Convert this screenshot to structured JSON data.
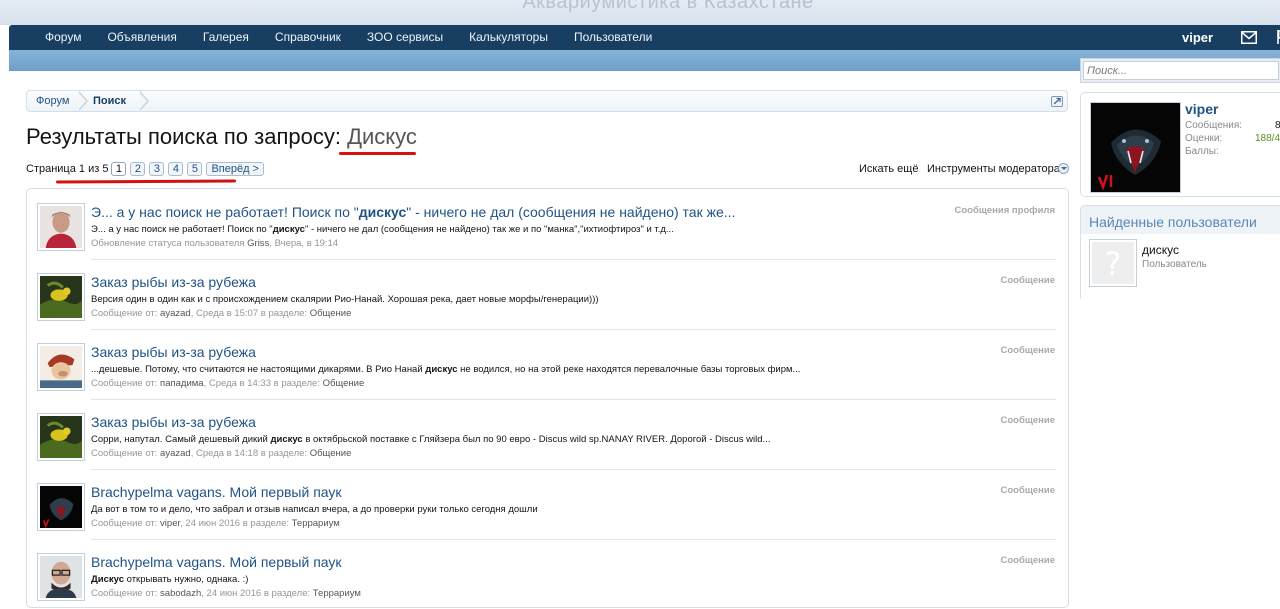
{
  "site_title": "Аквариумистика в Казахстане",
  "nav": {
    "tabs": [
      {
        "label": "Форум"
      },
      {
        "label": "Объявления"
      },
      {
        "label": "Галерея"
      },
      {
        "label": "Справочник"
      },
      {
        "label": "ЗОО сервисы"
      },
      {
        "label": "Калькуляторы"
      },
      {
        "label": "Пользователи"
      }
    ],
    "username": "viper",
    "icons": [
      "mail-icon",
      "flag-icon"
    ]
  },
  "quick_search": {
    "placeholder": "Поиск..."
  },
  "breadcrumb": {
    "items": [
      "Форум",
      "Поиск"
    ]
  },
  "heading": {
    "prefix": "Результаты поиска по запросу:",
    "term": "Дискус"
  },
  "pagination": {
    "label": "Страница 1 из 5",
    "pages": [
      "1",
      "2",
      "3",
      "4",
      "5"
    ],
    "current": "1",
    "next": "Вперёд >"
  },
  "actions": {
    "search_more": "Искать ещё",
    "mod_tools": "Инструменты модератора"
  },
  "annotation_color": "#d41212",
  "results": [
    {
      "title": "Э... а у нас поиск не работает! Поиск по \"дискус\" - ничего не дал (сообщения не найдено) так же...",
      "title_parts": [
        "Э... а у нас поиск не работает! Поиск по \"",
        "дискус",
        "\" - ничего не дал (сообщения не найдено) так же..."
      ],
      "snippet_parts": [
        "Э... а у нас поиск не работает! Поиск по \"",
        "дискус",
        "\" - ничего не дал (сообщения не найдено) так же и по \"манка\",\"ихтиофтироз\" и т.д..."
      ],
      "meta_prefix": "Обновление статуса пользователя",
      "author": "Griss",
      "date": "Вчера, в 19:14",
      "section_prefix": "",
      "section": "",
      "type": "Сообщения профиля",
      "avatar": "man-photo"
    },
    {
      "title_parts": [
        "Заказ рыбы из-за рубежа",
        "",
        ""
      ],
      "snippet_parts": [
        "Версия один в один как и с происхождением скалярии Рио-Нанай. Хорошая река, дает новые морфы/генерации)))",
        "",
        ""
      ],
      "meta_prefix": "Сообщение от:",
      "author": "ayazad",
      "date": "Среда в 15:07",
      "section_prefix": "в разделе:",
      "section": "Общение",
      "type": "Сообщение",
      "avatar": "bird-photo"
    },
    {
      "title_parts": [
        "Заказ рыбы из-за рубежа",
        "",
        ""
      ],
      "snippet_parts": [
        "...дешевые. Потому, что считаются не настоящими дикарями. В Рио Нанай ",
        "дискус",
        " не водился, но на этой реке находятся перевалочные базы торговых фирм..."
      ],
      "meta_prefix": "Сообщение от:",
      "author": "пападима",
      "date": "Среда в 14:33",
      "section_prefix": "в разделе:",
      "section": "Общение",
      "type": "Сообщение",
      "avatar": "cartoon-avatar"
    },
    {
      "title_parts": [
        "Заказ рыбы из-за рубежа",
        "",
        ""
      ],
      "snippet_parts": [
        "Сорри, напутал. Самый дешевый дикий ",
        "дискус",
        " в октябрьской поставке с Гляйзера был по 90 евро - Discus wild sp.NANAY RIVER. Дорогой - Discus wild..."
      ],
      "meta_prefix": "Сообщение от:",
      "author": "ayazad",
      "date": "Среда в 14:18",
      "section_prefix": "в разделе:",
      "section": "Общение",
      "type": "Сообщение",
      "avatar": "bird-photo"
    },
    {
      "title_parts": [
        "Brachypelma vagans. Мой первый паук",
        "",
        ""
      ],
      "snippet_parts": [
        "Да вот в том то и дело, что забрал и отзыв написал вчера, а до проверки руки только сегодня дошли",
        "",
        ""
      ],
      "meta_prefix": "Сообщение от:",
      "author": "viper",
      "date": "24 июн 2016",
      "section_prefix": "в разделе:",
      "section": "Террариум",
      "type": "Сообщение",
      "avatar": "snake-avatar"
    },
    {
      "title_parts": [
        "Brachypelma vagans. Мой первый паук",
        "",
        ""
      ],
      "snippet_parts": [
        "",
        "Дискус",
        " открывать нужно, однака. :)"
      ],
      "meta_prefix": "Сообщение от:",
      "author": "sabodazh",
      "date": "24 июн 2016",
      "section_prefix": "в разделе:",
      "section": "Террариум",
      "type": "Сообщение",
      "avatar": "glasses-man-photo"
    }
  ],
  "visitor": {
    "name": "viper",
    "stats": [
      {
        "label": "Сообщения:",
        "value": "8"
      },
      {
        "label": "Оценки:",
        "value": "188/4"
      },
      {
        "label": "Баллы:",
        "value": ""
      }
    ]
  },
  "found_users": {
    "title": "Найденные пользователи",
    "user": {
      "name": "дискус",
      "role": "Пользователь"
    }
  }
}
